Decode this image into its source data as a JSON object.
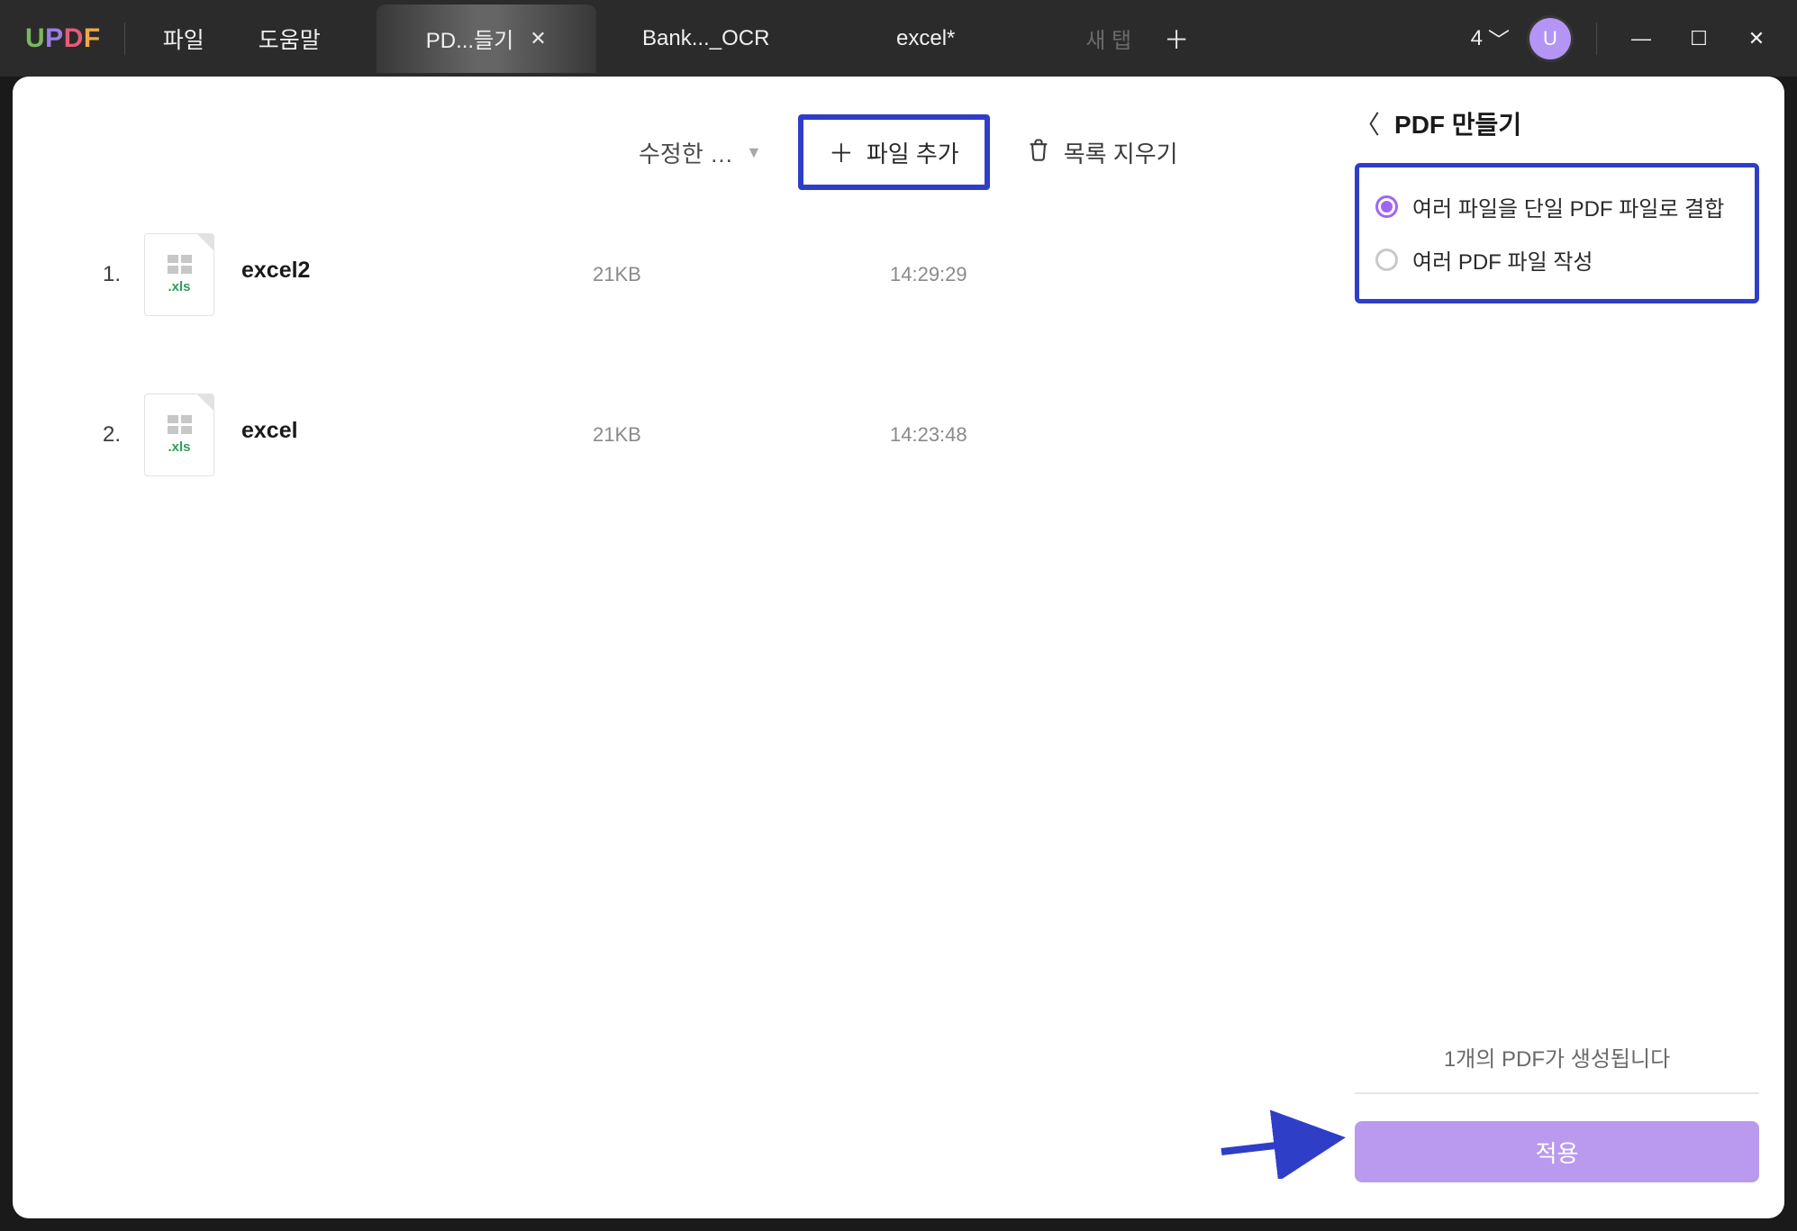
{
  "logo": {
    "u": "U",
    "p": "P",
    "d": "D",
    "f": "F"
  },
  "menu": {
    "file": "파일",
    "help": "도움말"
  },
  "tabs": [
    {
      "label": "PD...들기",
      "active": true,
      "closable": true
    },
    {
      "label": "Bank..._OCR",
      "active": false,
      "closable": false
    },
    {
      "label": "excel*",
      "active": false,
      "closable": false
    },
    {
      "label": "새 탭",
      "ghost": true
    }
  ],
  "header": {
    "count": "4",
    "avatar": "U"
  },
  "toolbar": {
    "sort": "수정한 …",
    "add_file": "파일 추가",
    "clear": "목록 지우기"
  },
  "files": [
    {
      "index": "1.",
      "name": "excel2",
      "ext": ".xls",
      "size": "21KB",
      "time": "14:29:29"
    },
    {
      "index": "2.",
      "name": "excel",
      "ext": ".xls",
      "size": "21KB",
      "time": "14:23:48"
    }
  ],
  "side": {
    "title": "PDF 만들기",
    "options": [
      {
        "label": "여러 파일을 단일 PDF 파일로 결합",
        "checked": true
      },
      {
        "label": "여러 PDF 파일 작성",
        "checked": false
      }
    ],
    "status": "1개의 PDF가 생성됩니다",
    "apply": "적용"
  }
}
